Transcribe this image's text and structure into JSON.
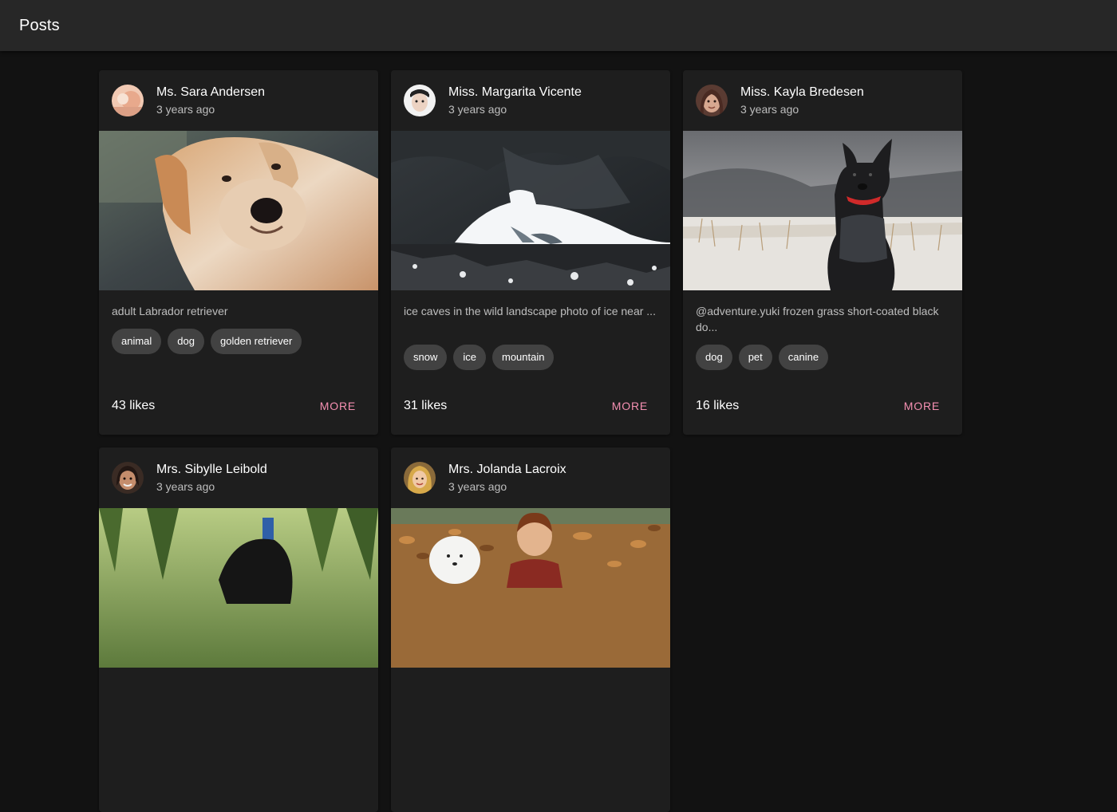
{
  "appbar": {
    "title": "Posts"
  },
  "posts": [
    {
      "author": "Ms. Sara Andersen",
      "time": "3 years ago",
      "description": "adult Labrador retriever",
      "tags": [
        "animal",
        "dog",
        "golden retriever"
      ],
      "likes": "43 likes",
      "more_label": "MORE"
    },
    {
      "author": "Miss. Margarita Vicente",
      "time": "3 years ago",
      "description": "ice caves in the wild landscape photo of ice near ...",
      "tags": [
        "snow",
        "ice",
        "mountain"
      ],
      "likes": "31 likes",
      "more_label": "MORE"
    },
    {
      "author": "Miss. Kayla Bredesen",
      "time": "3 years ago",
      "description": "@adventure.yuki frozen grass short-coated black do...",
      "tags": [
        "dog",
        "pet",
        "canine"
      ],
      "likes": "16 likes",
      "more_label": "MORE"
    },
    {
      "author": "Mrs. Sibylle Leibold",
      "time": "3 years ago"
    },
    {
      "author": "Mrs. Jolanda Lacroix",
      "time": "3 years ago"
    }
  ],
  "colors": {
    "background": "#121212",
    "appbar": "#272727",
    "card": "#1e1e1e",
    "chip": "#424242",
    "accent": "#f48fb1"
  }
}
